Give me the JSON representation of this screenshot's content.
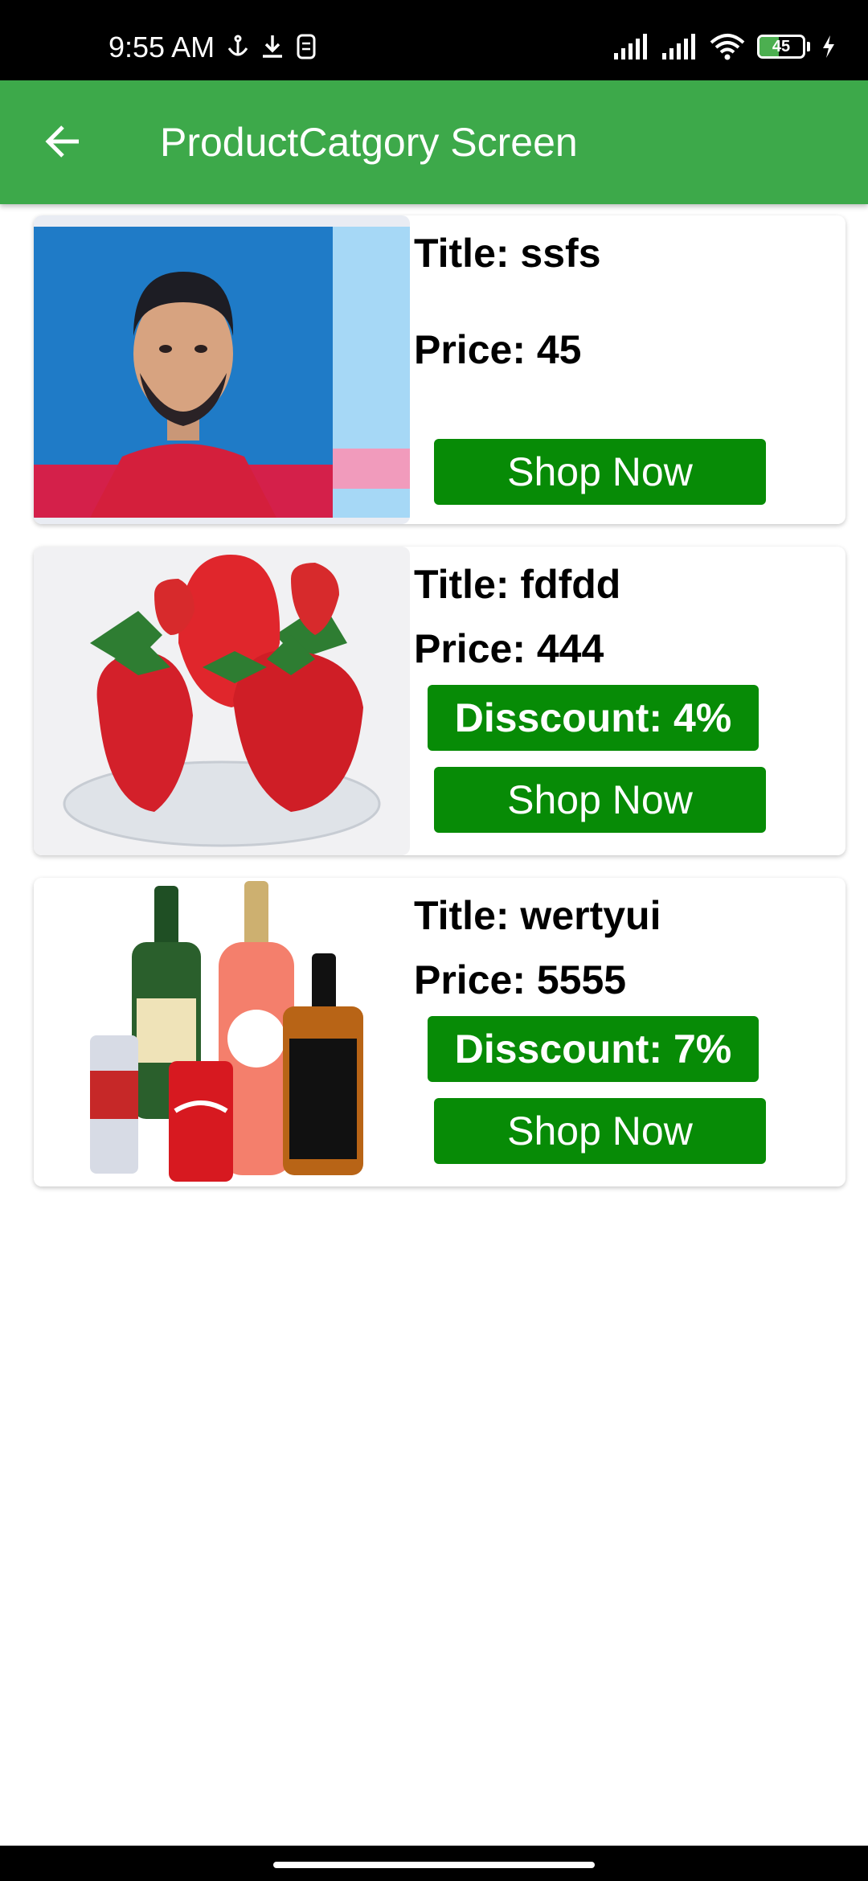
{
  "status_bar": {
    "time": "9:55 AM",
    "battery_level": "45",
    "battery_fraction": 0.45,
    "icons_left": [
      "anchor-icon",
      "download-icon",
      "sim-icon"
    ],
    "icons_right": [
      "signal-icon",
      "signal-icon",
      "wifi-icon",
      "battery-icon",
      "charging-icon"
    ]
  },
  "app_bar": {
    "title": "ProductCatgory Screen",
    "back_icon": "arrow-left-icon",
    "color": "#3da94a"
  },
  "products": [
    {
      "title": "Title: ssfs",
      "price": "Price: 45",
      "discount": "",
      "button": "Shop Now",
      "image": "person-photo"
    },
    {
      "title": "Title: fdfdd",
      "price": "Price: 444",
      "discount": "Disscount: 4%",
      "button": "Shop Now",
      "image": "strawberries-photo"
    },
    {
      "title": "Title: wertyui",
      "price": "Price: 5555",
      "discount": "Disscount: 7%",
      "button": "Shop Now",
      "image": "drinks-photo"
    }
  ],
  "colors": {
    "button_green": "#078b06",
    "app_bar_green": "#3da94a"
  }
}
